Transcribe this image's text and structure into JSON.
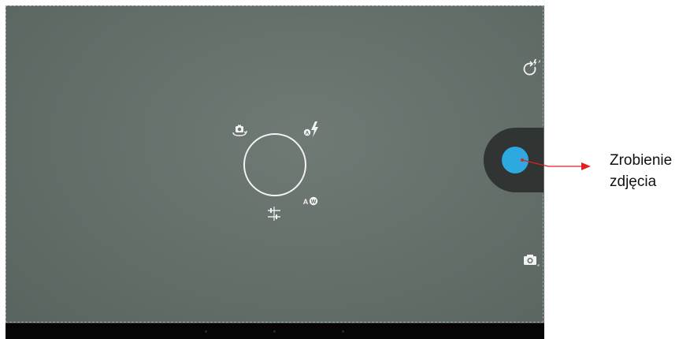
{
  "camera": {
    "shutter_label": "",
    "controls": {
      "switch_camera": "switch-camera-icon",
      "flash_auto": "flash-auto-icon",
      "white_balance_auto": "white-balance-auto-icon",
      "settings": "settings-sliders-icon",
      "rotate_flash": "rotate-flash-icon",
      "camera_mode": "camera-mode-icon"
    },
    "colors": {
      "shutter": "#2ea8e0",
      "annotation_arrow": "#e02020"
    }
  },
  "annotation": {
    "line1": "Zrobienie",
    "line2": "zdjęcia"
  }
}
